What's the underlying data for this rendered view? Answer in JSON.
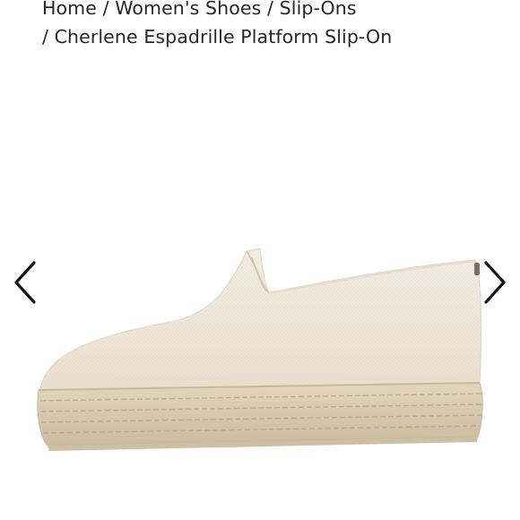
{
  "breadcrumb": {
    "home": "Home",
    "category": "Women's Shoes",
    "subcategory": "Slip-Ons",
    "current": "Cherlene Espadrille Platform Slip-On",
    "separator": "/"
  },
  "gallery": {
    "prev_icon": "chevron-left-icon",
    "next_icon": "chevron-right-icon",
    "image_subject": "espadrille-platform-slip-on-shoe"
  },
  "colors": {
    "text": "#262626",
    "canvas": "#eee6d8",
    "jute": "#d9cbb1",
    "arrow": "#111111"
  }
}
